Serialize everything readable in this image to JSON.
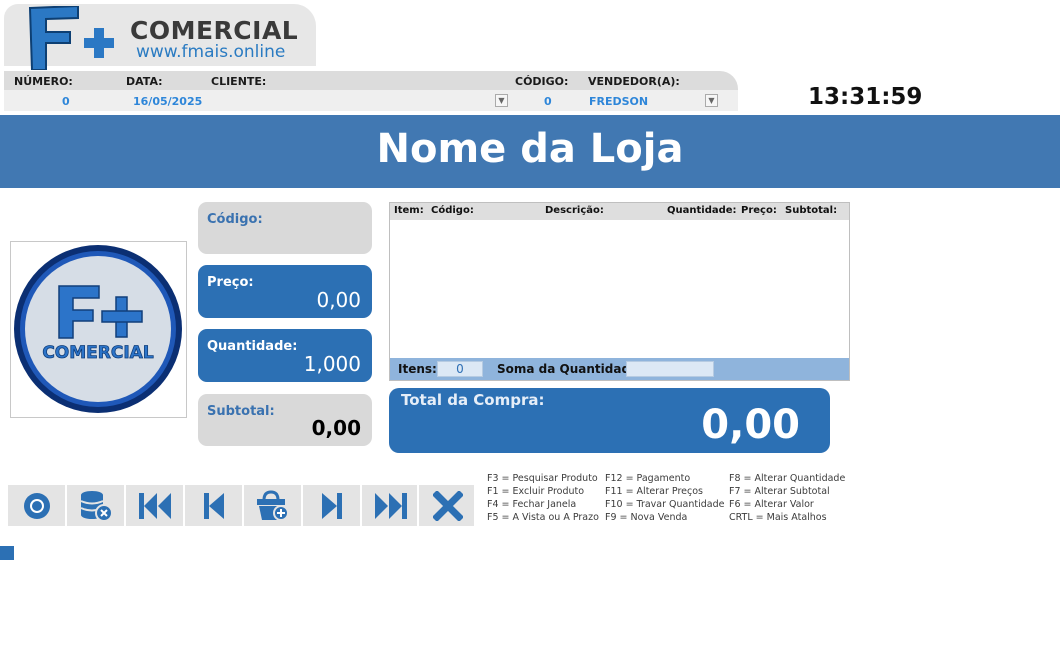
{
  "brand": {
    "name": "COMERCIAL",
    "url": "www.fmais.online",
    "logo_glyph": "F+",
    "logo_round_text": "COMERCIAL"
  },
  "header": {
    "numero_label": "NÚMERO:",
    "numero_value": "0",
    "data_label": "DATA:",
    "data_value": "16/05/2025",
    "cliente_label": "CLIENTE:",
    "cliente_value": "",
    "codigo_label": "CÓDIGO:",
    "codigo_value": "0",
    "vendedor_label": "VENDEDOR(A):",
    "vendedor_value": "FREDSON"
  },
  "clock": "13:31:59",
  "store_name": "Nome da Loja",
  "fields": {
    "codigo_label": "Código:",
    "codigo_value": "",
    "preco_label": "Preço:",
    "preco_value": "0,00",
    "quantidade_label": "Quantidade:",
    "quantidade_value": "1,000",
    "subtotal_label": "Subtotal:",
    "subtotal_value": "0,00"
  },
  "items_table": {
    "columns": [
      "Item:",
      "Código:",
      "Descrição:",
      "Quantidade:",
      "Preço:",
      "Subtotal:"
    ],
    "rows": [],
    "itens_label": "Itens:",
    "itens_value": "0",
    "soma_label": "Soma da Quantidade:",
    "soma_value": ""
  },
  "total": {
    "label": "Total da Compra:",
    "value": "0,00"
  },
  "toolbar": {
    "buttons": [
      "disc-icon",
      "database-delete-icon",
      "first-record-icon",
      "previous-record-icon",
      "basket-add-icon",
      "next-record-icon",
      "last-record-icon",
      "close-icon"
    ]
  },
  "shortcuts": {
    "col1": [
      "F3 = Pesquisar Produto",
      "F1 = Excluir Produto",
      "F4 = Fechar Janela",
      "F5 = A Vista ou A Prazo"
    ],
    "col2": [
      "F12 = Pagamento",
      "F11 = Alterar Preços",
      "F10 = Travar Quantidade",
      "F9 = Nova Venda"
    ],
    "col3": [
      "F8 = Alterar Quantidade",
      "F7 = Alterar Subtotal",
      "F6 = Alterar Valor",
      "CRTL = Mais Atalhos"
    ]
  },
  "colors": {
    "primary_blue": "#2c70b4",
    "banner_blue": "#4178b2",
    "value_blue": "#2e86d9",
    "panel_gray": "#d9d9d9"
  }
}
